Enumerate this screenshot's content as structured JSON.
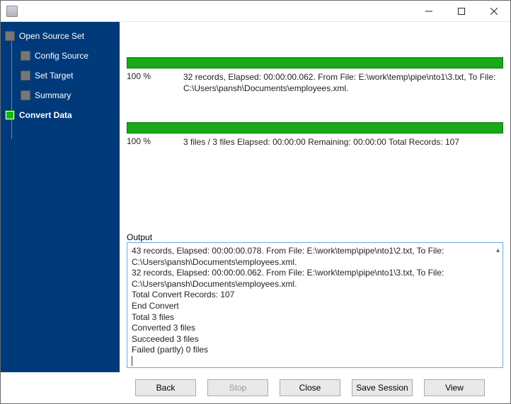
{
  "window": {
    "title": ""
  },
  "sidebar": {
    "items": [
      {
        "label": "Open Source Set"
      },
      {
        "label": "Config Source"
      },
      {
        "label": "Set Target"
      },
      {
        "label": "Summary"
      },
      {
        "label": "Convert Data"
      }
    ]
  },
  "progress": {
    "file": {
      "percent": "100 %",
      "text": "32 records,    Elapsed: 00:00:00.062.    From File: E:\\work\\temp\\pipe\\nto1\\3.txt,    To File: C:\\Users\\pansh\\Documents\\employees.xml."
    },
    "total": {
      "percent": "100 %",
      "text": "3 files / 3 files    Elapsed: 00:00:00    Remaining: 00:00:00    Total Records: 107"
    }
  },
  "output": {
    "label": "Output",
    "lines": [
      "43 records,    Elapsed: 00:00:00.078.    From File: E:\\work\\temp\\pipe\\nto1\\2.txt,    To File: C:\\Users\\pansh\\Documents\\employees.xml.",
      "32 records,    Elapsed: 00:00:00.062.    From File: E:\\work\\temp\\pipe\\nto1\\3.txt,    To File: C:\\Users\\pansh\\Documents\\employees.xml.",
      "Total Convert Records: 107",
      "End Convert",
      "Total 3 files",
      "Converted 3 files",
      "Succeeded 3 files",
      "Failed (partly) 0 files"
    ]
  },
  "buttons": {
    "back": "Back",
    "stop": "Stop",
    "close": "Close",
    "save_session": "Save Session",
    "view": "View"
  }
}
